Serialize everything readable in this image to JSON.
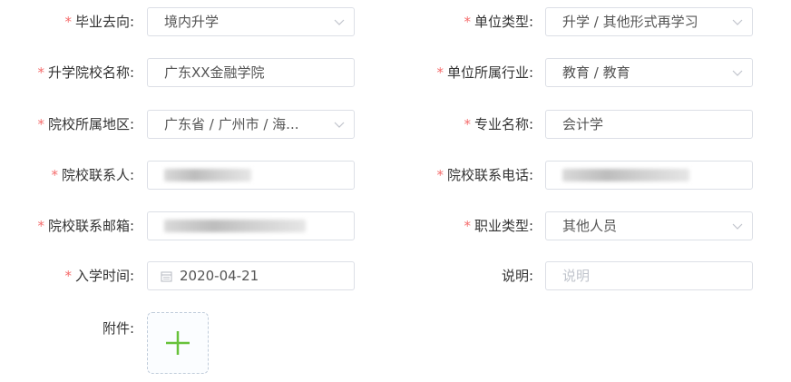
{
  "rows": [
    {
      "left": {
        "label": "毕业去向:",
        "required": true,
        "value": "境内升学",
        "type": "select"
      },
      "right": {
        "label": "单位类型:",
        "required": true,
        "value": "升学 / 其他形式再学习",
        "type": "select"
      }
    },
    {
      "left": {
        "label": "升学院校名称:",
        "required": true,
        "value": "广东XX金融学院",
        "type": "input"
      },
      "right": {
        "label": "单位所属行业:",
        "required": true,
        "value": "教育 / 教育",
        "type": "select"
      }
    },
    {
      "left": {
        "label": "院校所属地区:",
        "required": true,
        "value": "广东省 / 广州市 / 海...",
        "type": "select"
      },
      "right": {
        "label": "专业名称:",
        "required": true,
        "value": "会计学",
        "type": "input"
      }
    },
    {
      "left": {
        "label": "院校联系人:",
        "required": true,
        "value": "",
        "type": "redacted"
      },
      "right": {
        "label": "院校联系电话:",
        "required": true,
        "value": "",
        "type": "redacted"
      }
    },
    {
      "left": {
        "label": "院校联系邮箱:",
        "required": true,
        "value": "",
        "type": "redacted"
      },
      "right": {
        "label": "职业类型:",
        "required": true,
        "value": "其他人员",
        "type": "select"
      }
    },
    {
      "left": {
        "label": "入学时间:",
        "required": true,
        "value": "2020-04-21",
        "type": "date"
      },
      "right": {
        "label": "说明:",
        "required": false,
        "placeholder": "说明",
        "type": "input"
      }
    }
  ],
  "required_mark": "*",
  "attachment": {
    "label": "附件:",
    "icon": "plus-icon"
  },
  "colors": {
    "required": "#f56c6c",
    "border": "#dcdfe6",
    "plus": "#67c23a",
    "chevron": "#c0c4cc"
  }
}
